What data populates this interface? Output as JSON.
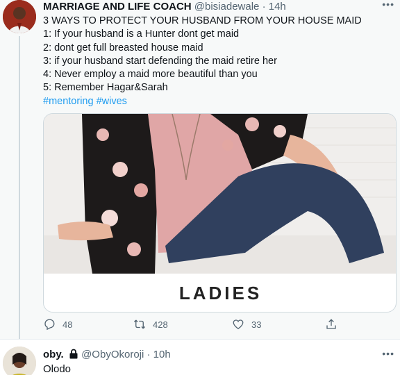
{
  "main_tweet": {
    "name": "MARRIAGE AND LIFE COACH",
    "handle": "@bisiadewale",
    "separator": "·",
    "time": "14h",
    "more": "•••",
    "lines": [
      "3 WAYS TO PROTECT YOUR HUSBAND FROM YOUR HOUSE MAID",
      "1: If your husband is a Hunter dont get maid",
      "2: dont get full breasted house maid",
      "3: if your husband start defending the maid retire her",
      "4: Never employ a maid more beautiful than you",
      "5: Remember Hagar&Sarah"
    ],
    "hashtags": "#mentoring #wives",
    "card": {
      "caption": "LADIES"
    },
    "actions": {
      "reply_count": "48",
      "retweet_count": "428",
      "like_count": "33"
    }
  },
  "reply_tweet": {
    "name": "oby.",
    "handle": "@ObyOkoroji",
    "separator": "·",
    "time": "10h",
    "more": "•••",
    "text": "Olodo"
  },
  "colors": {
    "accent": "#1d9bf0",
    "muted": "#536471",
    "background": "#f7f9f9"
  },
  "icons": [
    "more-icon",
    "reply-icon",
    "retweet-icon",
    "like-icon",
    "share-icon",
    "lock-icon"
  ]
}
